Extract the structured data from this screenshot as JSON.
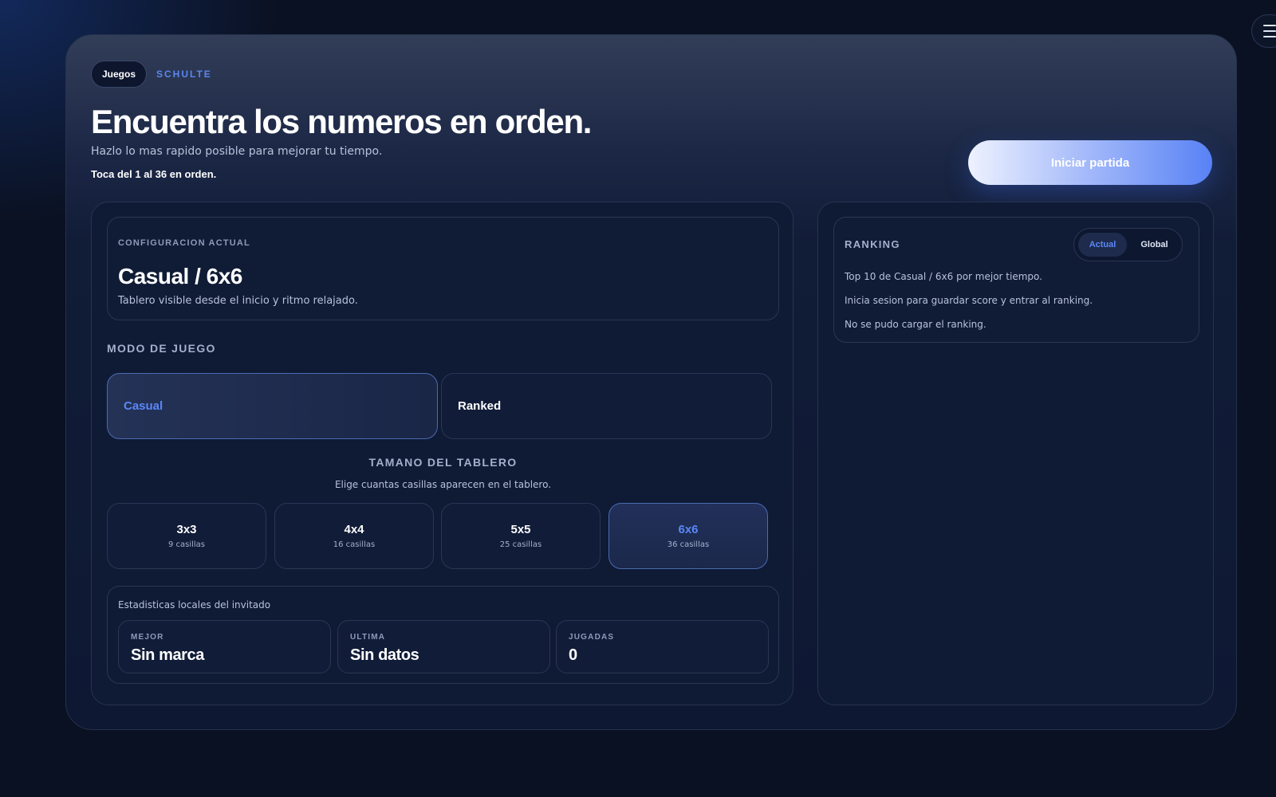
{
  "header": {
    "crumb_parent": "Juegos",
    "crumb_current": "SCHULTE",
    "title": "Encuentra los numeros en orden.",
    "subtitle": "Hazlo lo mas rapido posible para mejorar tu tiempo.",
    "hint": "Toca del 1 al 36 en orden.",
    "start_label": "Iniciar partida",
    "menu_icon": "hamburger-icon"
  },
  "config": {
    "label": "CONFIGURACION ACTUAL",
    "value": "Casual / 6x6",
    "description": "Tablero visible desde el inicio y ritmo relajado."
  },
  "mode": {
    "label": "MODO DE JUEGO",
    "options": [
      {
        "label": "Casual",
        "selected": true
      },
      {
        "label": "Ranked",
        "selected": false
      }
    ]
  },
  "board": {
    "title": "TAMANO DEL TABLERO",
    "description": "Elige cuantas casillas aparecen en el tablero.",
    "sizes": [
      {
        "name": "3x3",
        "cells": "9 casillas",
        "selected": false
      },
      {
        "name": "4x4",
        "cells": "16 casillas",
        "selected": false
      },
      {
        "name": "5x5",
        "cells": "25 casillas",
        "selected": false
      },
      {
        "name": "6x6",
        "cells": "36 casillas",
        "selected": true
      }
    ]
  },
  "stats": {
    "title": "Estadisticas locales del invitado",
    "items": [
      {
        "label": "MEJOR",
        "value": "Sin marca"
      },
      {
        "label": "ULTIMA",
        "value": "Sin datos"
      },
      {
        "label": "JUGADAS",
        "value": "0"
      }
    ]
  },
  "ranking": {
    "title": "RANKING",
    "tabs": [
      {
        "label": "Actual",
        "selected": true
      },
      {
        "label": "Global",
        "selected": false
      }
    ],
    "lines": [
      "Top 10 de Casual / 6x6 por mejor tiempo.",
      "Inicia sesion para guardar score y entrar al ranking.",
      "No se pudo cargar el ranking."
    ]
  },
  "colors": {
    "accent": "#5a87f7",
    "background": "#0a1122",
    "panel": "#0f1a35"
  }
}
